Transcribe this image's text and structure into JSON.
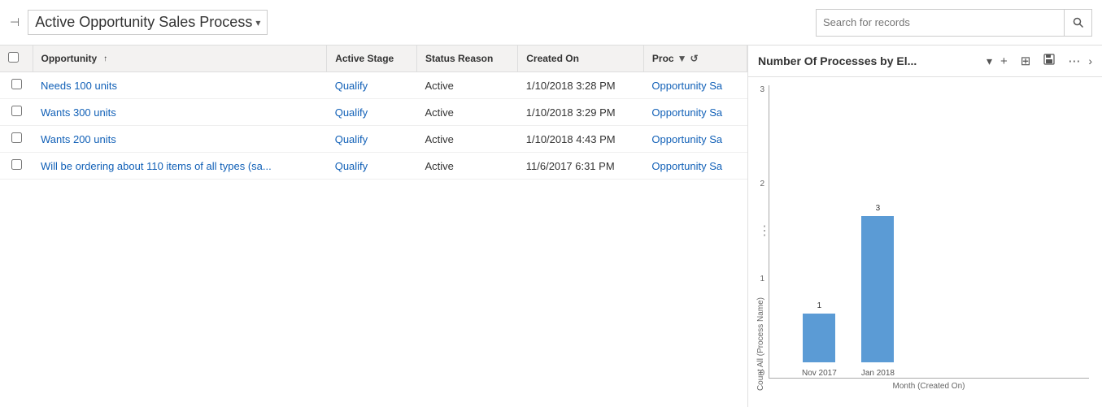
{
  "header": {
    "pin_icon": "📌",
    "title": "Active Opportunity Sales Process",
    "dropdown_icon": "▾",
    "search_placeholder": "Search for records",
    "search_icon": "🔍"
  },
  "table": {
    "columns": [
      {
        "key": "checkbox",
        "label": ""
      },
      {
        "key": "opportunity",
        "label": "Opportunity",
        "sortable": true
      },
      {
        "key": "active_stage",
        "label": "Active Stage"
      },
      {
        "key": "status_reason",
        "label": "Status Reason"
      },
      {
        "key": "created_on",
        "label": "Created On"
      },
      {
        "key": "process",
        "label": "Proc"
      }
    ],
    "rows": [
      {
        "opportunity": "Needs 100 units",
        "active_stage": "Qualify",
        "status_reason": "Active",
        "created_on": "1/10/2018 3:28 PM",
        "process": "Opportunity Sa"
      },
      {
        "opportunity": "Wants 300 units",
        "active_stage": "Qualify",
        "status_reason": "Active",
        "created_on": "1/10/2018 3:29 PM",
        "process": "Opportunity Sa"
      },
      {
        "opportunity": "Wants 200 units",
        "active_stage": "Qualify",
        "status_reason": "Active",
        "created_on": "1/10/2018 4:43 PM",
        "process": "Opportunity Sa"
      },
      {
        "opportunity": "Will be ordering about 110 items of all types (sa...",
        "active_stage": "Qualify",
        "status_reason": "Active",
        "created_on": "11/6/2017 6:31 PM",
        "process": "Opportunity Sa"
      }
    ]
  },
  "chart": {
    "title": "Number Of Processes by El...",
    "chevron_icon": "▾",
    "y_axis_label": "Count All (Process Name)",
    "x_axis_label": "Month (Created On)",
    "y_ticks": [
      "0",
      "1",
      "2",
      "3"
    ],
    "bars": [
      {
        "label": "Nov 2017",
        "value": 1,
        "height_pct": 33
      },
      {
        "label": "Jan 2018",
        "value": 3,
        "height_pct": 100
      }
    ],
    "actions": {
      "add": "+",
      "layout": "⊞",
      "save": "💾",
      "more": "⋯"
    }
  }
}
